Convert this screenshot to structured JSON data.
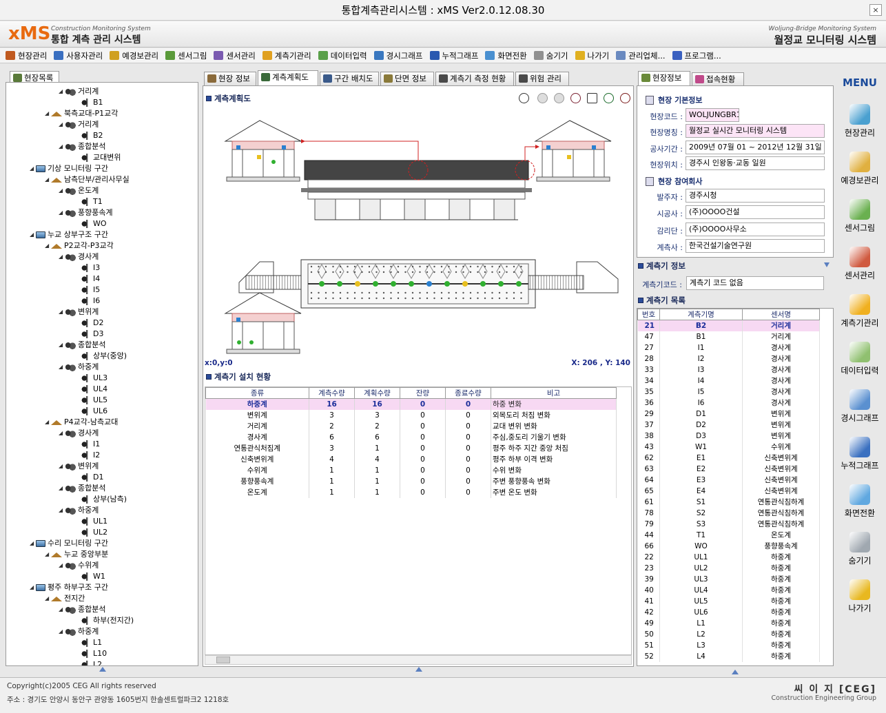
{
  "window": {
    "title": "통합계측관리시스템  : xMS Ver2.0.12.08.30",
    "close": "×"
  },
  "header": {
    "logo": "xMS",
    "logo_sub": "Construction  Monitoring System",
    "logo_name": "통합 계측 관리 시스템",
    "right_sub": "Woljung-Bridge  Monitoring System",
    "right_name": "월정교 모니터링 시스템"
  },
  "menubar": [
    {
      "label": "현장관리",
      "color": "#c05a20"
    },
    {
      "label": "사용자관리",
      "color": "#3a6fc0"
    },
    {
      "label": "예경보관리",
      "color": "#d0a020"
    },
    {
      "label": "센서그림",
      "color": "#5a9a3a"
    },
    {
      "label": "센서관리",
      "color": "#7a5ab0"
    },
    {
      "label": "계측기관리",
      "color": "#e0a020"
    },
    {
      "label": "데이터입력",
      "color": "#5aa04a"
    },
    {
      "label": "경시그래프",
      "color": "#3a78c0"
    },
    {
      "label": "누적그래프",
      "color": "#2a58b0"
    },
    {
      "label": "화면전환",
      "color": "#4a90d0"
    },
    {
      "label": "숨기기",
      "color": "#909090"
    },
    {
      "label": "나가기",
      "color": "#e0b020"
    },
    {
      "label": "관리업체...",
      "color": "#6a8ac0"
    },
    {
      "label": "프로그램...",
      "color": "#3a60c0"
    }
  ],
  "tree": {
    "tab": "현장목록",
    "nodes": [
      {
        "label": "거리계",
        "level": 3,
        "icon": "grp",
        "toggle": "◢"
      },
      {
        "label": "B1",
        "level": 4,
        "icon": "sen",
        "toggle": ""
      },
      {
        "label": "북측교대-P1교각",
        "level": 2,
        "icon": "house",
        "toggle": "◢"
      },
      {
        "label": "거리계",
        "level": 3,
        "icon": "grp",
        "toggle": "◢"
      },
      {
        "label": "B2",
        "level": 4,
        "icon": "sen",
        "toggle": ""
      },
      {
        "label": "종합분석",
        "level": 3,
        "icon": "grp",
        "toggle": "◢"
      },
      {
        "label": "교대변위",
        "level": 4,
        "icon": "sen",
        "toggle": ""
      },
      {
        "label": "기상 모니터링 구간",
        "level": 1,
        "icon": "mon",
        "toggle": "◢"
      },
      {
        "label": "남측단부/관리사무실",
        "level": 2,
        "icon": "house",
        "toggle": "◢"
      },
      {
        "label": "온도계",
        "level": 3,
        "icon": "grp",
        "toggle": "◢"
      },
      {
        "label": "T1",
        "level": 4,
        "icon": "sen",
        "toggle": ""
      },
      {
        "label": "풍향풍속계",
        "level": 3,
        "icon": "grp",
        "toggle": "◢"
      },
      {
        "label": "WO",
        "level": 4,
        "icon": "sen",
        "toggle": ""
      },
      {
        "label": "누교 상부구조 구간",
        "level": 1,
        "icon": "mon",
        "toggle": "◢"
      },
      {
        "label": "P2교각-P3교각",
        "level": 2,
        "icon": "house",
        "toggle": "◢"
      },
      {
        "label": "경사계",
        "level": 3,
        "icon": "grp",
        "toggle": "◢"
      },
      {
        "label": "I3",
        "level": 4,
        "icon": "sen",
        "toggle": ""
      },
      {
        "label": "I4",
        "level": 4,
        "icon": "sen",
        "toggle": ""
      },
      {
        "label": "I5",
        "level": 4,
        "icon": "sen",
        "toggle": ""
      },
      {
        "label": "I6",
        "level": 4,
        "icon": "sen",
        "toggle": ""
      },
      {
        "label": "변위계",
        "level": 3,
        "icon": "grp",
        "toggle": "◢"
      },
      {
        "label": "D2",
        "level": 4,
        "icon": "sen",
        "toggle": ""
      },
      {
        "label": "D3",
        "level": 4,
        "icon": "sen",
        "toggle": ""
      },
      {
        "label": "종합분석",
        "level": 3,
        "icon": "grp",
        "toggle": "◢"
      },
      {
        "label": "상부(중앙)",
        "level": 4,
        "icon": "sen",
        "toggle": ""
      },
      {
        "label": "하중계",
        "level": 3,
        "icon": "grp",
        "toggle": "◢"
      },
      {
        "label": "UL3",
        "level": 4,
        "icon": "sen",
        "toggle": ""
      },
      {
        "label": "UL4",
        "level": 4,
        "icon": "sen",
        "toggle": ""
      },
      {
        "label": "UL5",
        "level": 4,
        "icon": "sen",
        "toggle": ""
      },
      {
        "label": "UL6",
        "level": 4,
        "icon": "sen",
        "toggle": ""
      },
      {
        "label": "P4교각-남측교대",
        "level": 2,
        "icon": "house",
        "toggle": "◢"
      },
      {
        "label": "경사계",
        "level": 3,
        "icon": "grp",
        "toggle": "◢"
      },
      {
        "label": "I1",
        "level": 4,
        "icon": "sen",
        "toggle": ""
      },
      {
        "label": "I2",
        "level": 4,
        "icon": "sen",
        "toggle": ""
      },
      {
        "label": "변위계",
        "level": 3,
        "icon": "grp",
        "toggle": "◢"
      },
      {
        "label": "D1",
        "level": 4,
        "icon": "sen",
        "toggle": ""
      },
      {
        "label": "종합분석",
        "level": 3,
        "icon": "grp",
        "toggle": "◢"
      },
      {
        "label": "상부(남측)",
        "level": 4,
        "icon": "sen",
        "toggle": ""
      },
      {
        "label": "하중계",
        "level": 3,
        "icon": "grp",
        "toggle": "◢"
      },
      {
        "label": "UL1",
        "level": 4,
        "icon": "sen",
        "toggle": ""
      },
      {
        "label": "UL2",
        "level": 4,
        "icon": "sen",
        "toggle": ""
      },
      {
        "label": "수리 모니터링 구간",
        "level": 1,
        "icon": "mon",
        "toggle": "◢"
      },
      {
        "label": "누교 중앙부분",
        "level": 2,
        "icon": "house",
        "toggle": "◢"
      },
      {
        "label": "수위계",
        "level": 3,
        "icon": "grp",
        "toggle": "◢"
      },
      {
        "label": "W1",
        "level": 4,
        "icon": "sen",
        "toggle": ""
      },
      {
        "label": "평주 하부구조 구간",
        "level": 1,
        "icon": "mon",
        "toggle": "◢"
      },
      {
        "label": "전지간",
        "level": 2,
        "icon": "house",
        "toggle": "◢"
      },
      {
        "label": "종합분석",
        "level": 3,
        "icon": "grp",
        "toggle": "◢"
      },
      {
        "label": "하부(전지간)",
        "level": 4,
        "icon": "sen",
        "toggle": ""
      },
      {
        "label": "하중계",
        "level": 3,
        "icon": "grp",
        "toggle": "◢"
      },
      {
        "label": "L1",
        "level": 4,
        "icon": "sen",
        "toggle": ""
      },
      {
        "label": "L10",
        "level": 4,
        "icon": "sen",
        "toggle": ""
      },
      {
        "label": "L2",
        "level": 4,
        "icon": "sen",
        "toggle": ""
      }
    ]
  },
  "tabs": [
    {
      "label": "현장 정보",
      "color": "#8a6a3a"
    },
    {
      "label": "계측계획도",
      "color": "#3a6a3a",
      "active": true
    },
    {
      "label": "구간 배치도",
      "color": "#3a5a8a"
    },
    {
      "label": "단면 정보",
      "color": "#8a7a3a"
    },
    {
      "label": "계측기 측정 현황",
      "color": "#4a4a4a"
    },
    {
      "label": "위험 관리",
      "color": "#4a4a4a"
    }
  ],
  "plan": {
    "title": "계측계획도",
    "coord_left": "x:0,y:0",
    "coord_right": "X:  206 , Y:  140"
  },
  "install": {
    "title": "계측기 설치 현황",
    "columns": [
      "종류",
      "계측수량",
      "계획수량",
      "잔량",
      "종료수량",
      "비고"
    ],
    "rows": [
      [
        "하중계",
        "16",
        "16",
        "0",
        "0",
        "하중 변화"
      ],
      [
        "변위계",
        "3",
        "3",
        "0",
        "0",
        "외목도리 처짐 변화"
      ],
      [
        "거리계",
        "2",
        "2",
        "0",
        "0",
        "교대 변위 변화"
      ],
      [
        "경사계",
        "6",
        "6",
        "0",
        "0",
        "주심,중도리 기울기 변화"
      ],
      [
        "연통관식처짐계",
        "3",
        "1",
        "0",
        "0",
        "평주 하주 지간 중앙 처짐"
      ],
      [
        "신축변위계",
        "4",
        "4",
        "0",
        "0",
        "평주 하부 이격 변화"
      ],
      [
        "수위계",
        "1",
        "1",
        "0",
        "0",
        "수위 변화"
      ],
      [
        "풍향풍속계",
        "1",
        "1",
        "0",
        "0",
        "주변 풍향풍속 변화"
      ],
      [
        "온도계",
        "1",
        "1",
        "0",
        "0",
        "주변 온도 변화"
      ]
    ]
  },
  "info_tabs": [
    "현장정보",
    "접속현황"
  ],
  "site": {
    "basic_title": "현장 기본정보",
    "code_label": "현장코드 :",
    "code": "WOLJUNGBR1",
    "name_label": "현장명칭 :",
    "name": "월정교 실시간 모니터링 시스템",
    "period_label": "공사기간 :",
    "period": "2009년 07월 01 ~ 2012년 12월 31일",
    "location_label": "현장위치 :",
    "location": "경주시 인왕동·교동 일원",
    "company_title": "현장 참여회사",
    "client_label": "발주자 :",
    "client": "경주시청",
    "builder_label": "시공사 :",
    "builder": "(주)OOOO건설",
    "supervisor_label": "감리단 :",
    "supervisor": "(주)OOOO사무소",
    "measure_label": "계측사 :",
    "measure": "한국건설기술연구원"
  },
  "instrument": {
    "title": "계측기 정보",
    "code_label": "계측기코드 :",
    "code": "계측기 코드 없음",
    "list_title": "계측기 목록",
    "columns": [
      "번호",
      "계측기명",
      "센서명"
    ],
    "rows": [
      [
        "21",
        "B2",
        "거리계"
      ],
      [
        "47",
        "B1",
        "거리계"
      ],
      [
        "27",
        "I1",
        "경사계"
      ],
      [
        "28",
        "I2",
        "경사계"
      ],
      [
        "33",
        "I3",
        "경사계"
      ],
      [
        "34",
        "I4",
        "경사계"
      ],
      [
        "35",
        "I5",
        "경사계"
      ],
      [
        "36",
        "I6",
        "경사계"
      ],
      [
        "29",
        "D1",
        "변위계"
      ],
      [
        "37",
        "D2",
        "변위계"
      ],
      [
        "38",
        "D3",
        "변위계"
      ],
      [
        "43",
        "W1",
        "수위계"
      ],
      [
        "62",
        "E1",
        "신축변위계"
      ],
      [
        "63",
        "E2",
        "신축변위계"
      ],
      [
        "64",
        "E3",
        "신축변위계"
      ],
      [
        "65",
        "E4",
        "신축변위계"
      ],
      [
        "61",
        "S1",
        "연통관식침하계"
      ],
      [
        "78",
        "S2",
        "연통관식침하계"
      ],
      [
        "79",
        "S3",
        "연통관식침하계"
      ],
      [
        "44",
        "T1",
        "온도계"
      ],
      [
        "66",
        "WO",
        "풍향풍속계"
      ],
      [
        "22",
        "UL1",
        "하중계"
      ],
      [
        "23",
        "UL2",
        "하중계"
      ],
      [
        "39",
        "UL3",
        "하중계"
      ],
      [
        "40",
        "UL4",
        "하중계"
      ],
      [
        "41",
        "UL5",
        "하중계"
      ],
      [
        "42",
        "UL6",
        "하중계"
      ],
      [
        "49",
        "L1",
        "하중계"
      ],
      [
        "50",
        "L2",
        "하중계"
      ],
      [
        "51",
        "L3",
        "하중계"
      ],
      [
        "52",
        "L4",
        "하중계"
      ]
    ]
  },
  "rmenu": {
    "title": "MENU",
    "items": [
      {
        "label": "현장관리",
        "color": "#4aa0d0"
      },
      {
        "label": "예경보관리",
        "color": "#e0b040"
      },
      {
        "label": "센서그림",
        "color": "#6ab050"
      },
      {
        "label": "센서관리",
        "color": "#d05a40"
      },
      {
        "label": "계측기관리",
        "color": "#f0b020"
      },
      {
        "label": "데이터입력",
        "color": "#90c070"
      },
      {
        "label": "경시그래프",
        "color": "#5a90d0"
      },
      {
        "label": "누적그래프",
        "color": "#3a70c0"
      },
      {
        "label": "화면전환",
        "color": "#60a8e0"
      },
      {
        "label": "숨기기",
        "color": "#a0a8b0"
      },
      {
        "label": "나가기",
        "color": "#e8b820"
      }
    ]
  },
  "footer": {
    "copyright": "Copyright(c)2005 CEG All rights reserved",
    "address": "주소 : 경기도 안양시 동안구 관양동 1605번지 한솔센트럴파크2 1218호",
    "brand": "씨 이 지 [CEG]",
    "brand_sub": "Construction  Engineering Group"
  }
}
